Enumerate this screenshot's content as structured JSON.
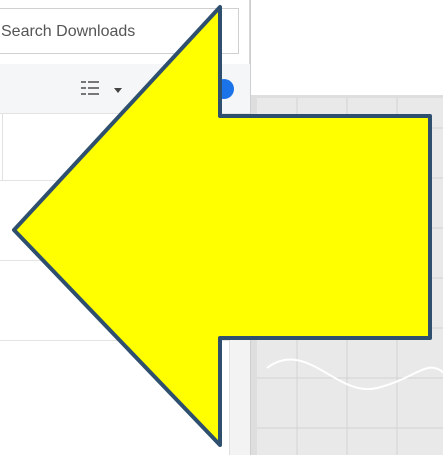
{
  "search": {
    "placeholder": "Search Downloads"
  },
  "toolbar": {
    "view_icon": "details-view-icon",
    "dropdown_icon": "chevron-down-icon",
    "help_icon": "help-icon"
  },
  "overlay": {
    "shape": "left-arrow",
    "fill": "#ffff00",
    "stroke": "#2f4f6f"
  },
  "background_window": {
    "content": "blank chart area"
  }
}
